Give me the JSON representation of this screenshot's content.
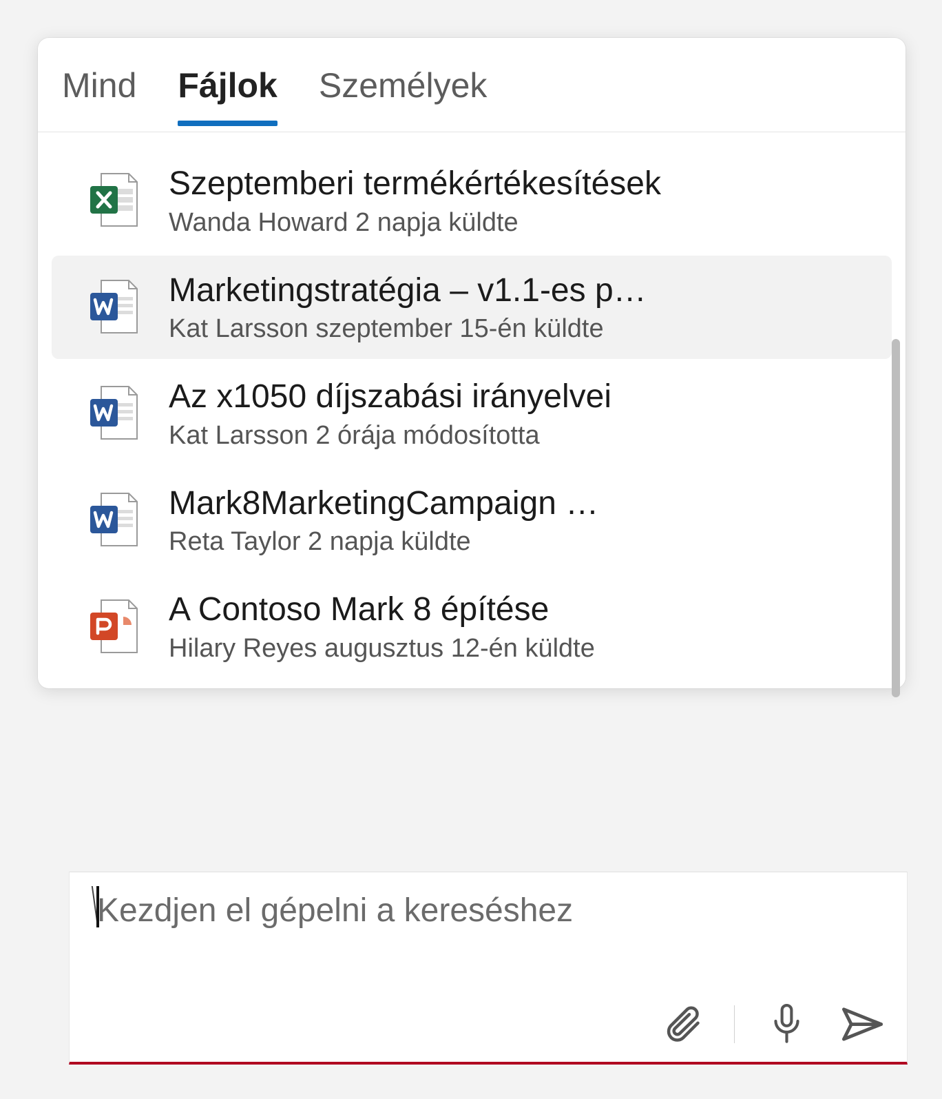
{
  "tabs": {
    "all": "Mind",
    "files": "Fájlok",
    "people": "Személyek",
    "activeIndex": 1
  },
  "files": [
    {
      "icon": "excel",
      "title": "Szeptemberi termékértékesítések",
      "subtitle": "Wanda Howard 2 napja küldte",
      "highlight": false
    },
    {
      "icon": "word",
      "title": "Marketingstratégia – v1.1-es p…",
      "subtitle": "Kat Larsson szeptember 15-én küldte",
      "highlight": true
    },
    {
      "icon": "word",
      "title": "Az x1050 díjszabási irányelvei",
      "subtitle": "Kat Larsson 2 órája módosította",
      "highlight": false
    },
    {
      "icon": "word",
      "title": "Mark8MarketingCampaign …",
      "subtitle": "Reta Taylor 2 napja küldte",
      "highlight": false
    },
    {
      "icon": "powerpoint",
      "title": "A Contoso Mark 8 építése",
      "subtitle": "Hilary Reyes augusztus 12-én küldte",
      "highlight": false
    }
  ],
  "compose": {
    "placeholder": "Kezdjen el gépelni a kereséshez"
  },
  "icons": {
    "attach": "attach-icon",
    "mic": "mic-icon",
    "send": "send-icon"
  },
  "colors": {
    "word": "#2b579a",
    "excel": "#217346",
    "powerpoint": "#d24726",
    "accent": "#106ebe"
  }
}
